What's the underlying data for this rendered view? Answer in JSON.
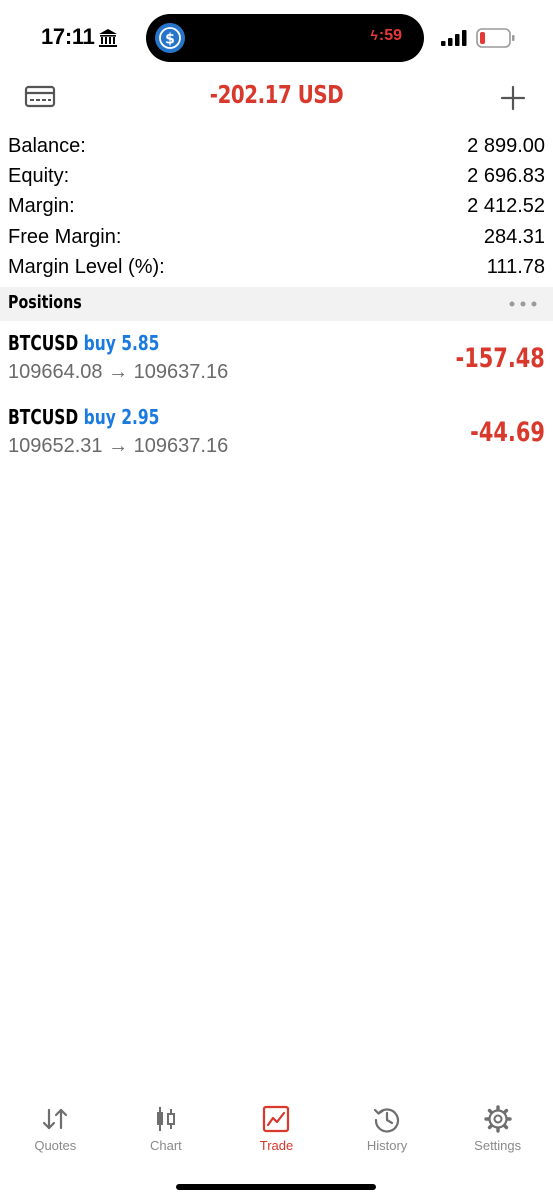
{
  "status_bar": {
    "time": "17:11",
    "island_timer": ":59",
    "battery_color": "#e53935"
  },
  "header": {
    "title": "-202.17 USD",
    "title_color": "#d9382c",
    "left_icon": "card-icon",
    "right_icon": "plus-icon"
  },
  "summary": [
    {
      "label": "Balance:",
      "value": "2 899.00"
    },
    {
      "label": "Equity:",
      "value": "2 696.83"
    },
    {
      "label": "Margin:",
      "value": "2 412.52"
    },
    {
      "label": "Free Margin:",
      "value": "284.31"
    },
    {
      "label": "Margin Level (%):",
      "value": "111.78"
    }
  ],
  "positions": {
    "title": "Positions",
    "items": [
      {
        "symbol": "BTCUSD",
        "side": "buy 5.85",
        "open_price": "109664.08",
        "arrow": "→",
        "current_price": "109637.16",
        "profit": "-157.48"
      },
      {
        "symbol": "BTCUSD",
        "side": "buy 2.95",
        "open_price": "109652.31",
        "arrow": "→",
        "current_price": "109637.16",
        "profit": "-44.69"
      }
    ]
  },
  "tabs": [
    {
      "label": "Quotes",
      "icon": "quotes-arrows-icon",
      "active": false
    },
    {
      "label": "Chart",
      "icon": "candlestick-icon",
      "active": false
    },
    {
      "label": "Trade",
      "icon": "trade-chart-icon",
      "active": true
    },
    {
      "label": "History",
      "icon": "history-clock-icon",
      "active": false
    },
    {
      "label": "Settings",
      "icon": "gear-icon",
      "active": false
    }
  ],
  "colors": {
    "accent_red": "#d9382c",
    "buy_blue": "#1a7ae0",
    "muted_gray": "#8a8a8a"
  }
}
